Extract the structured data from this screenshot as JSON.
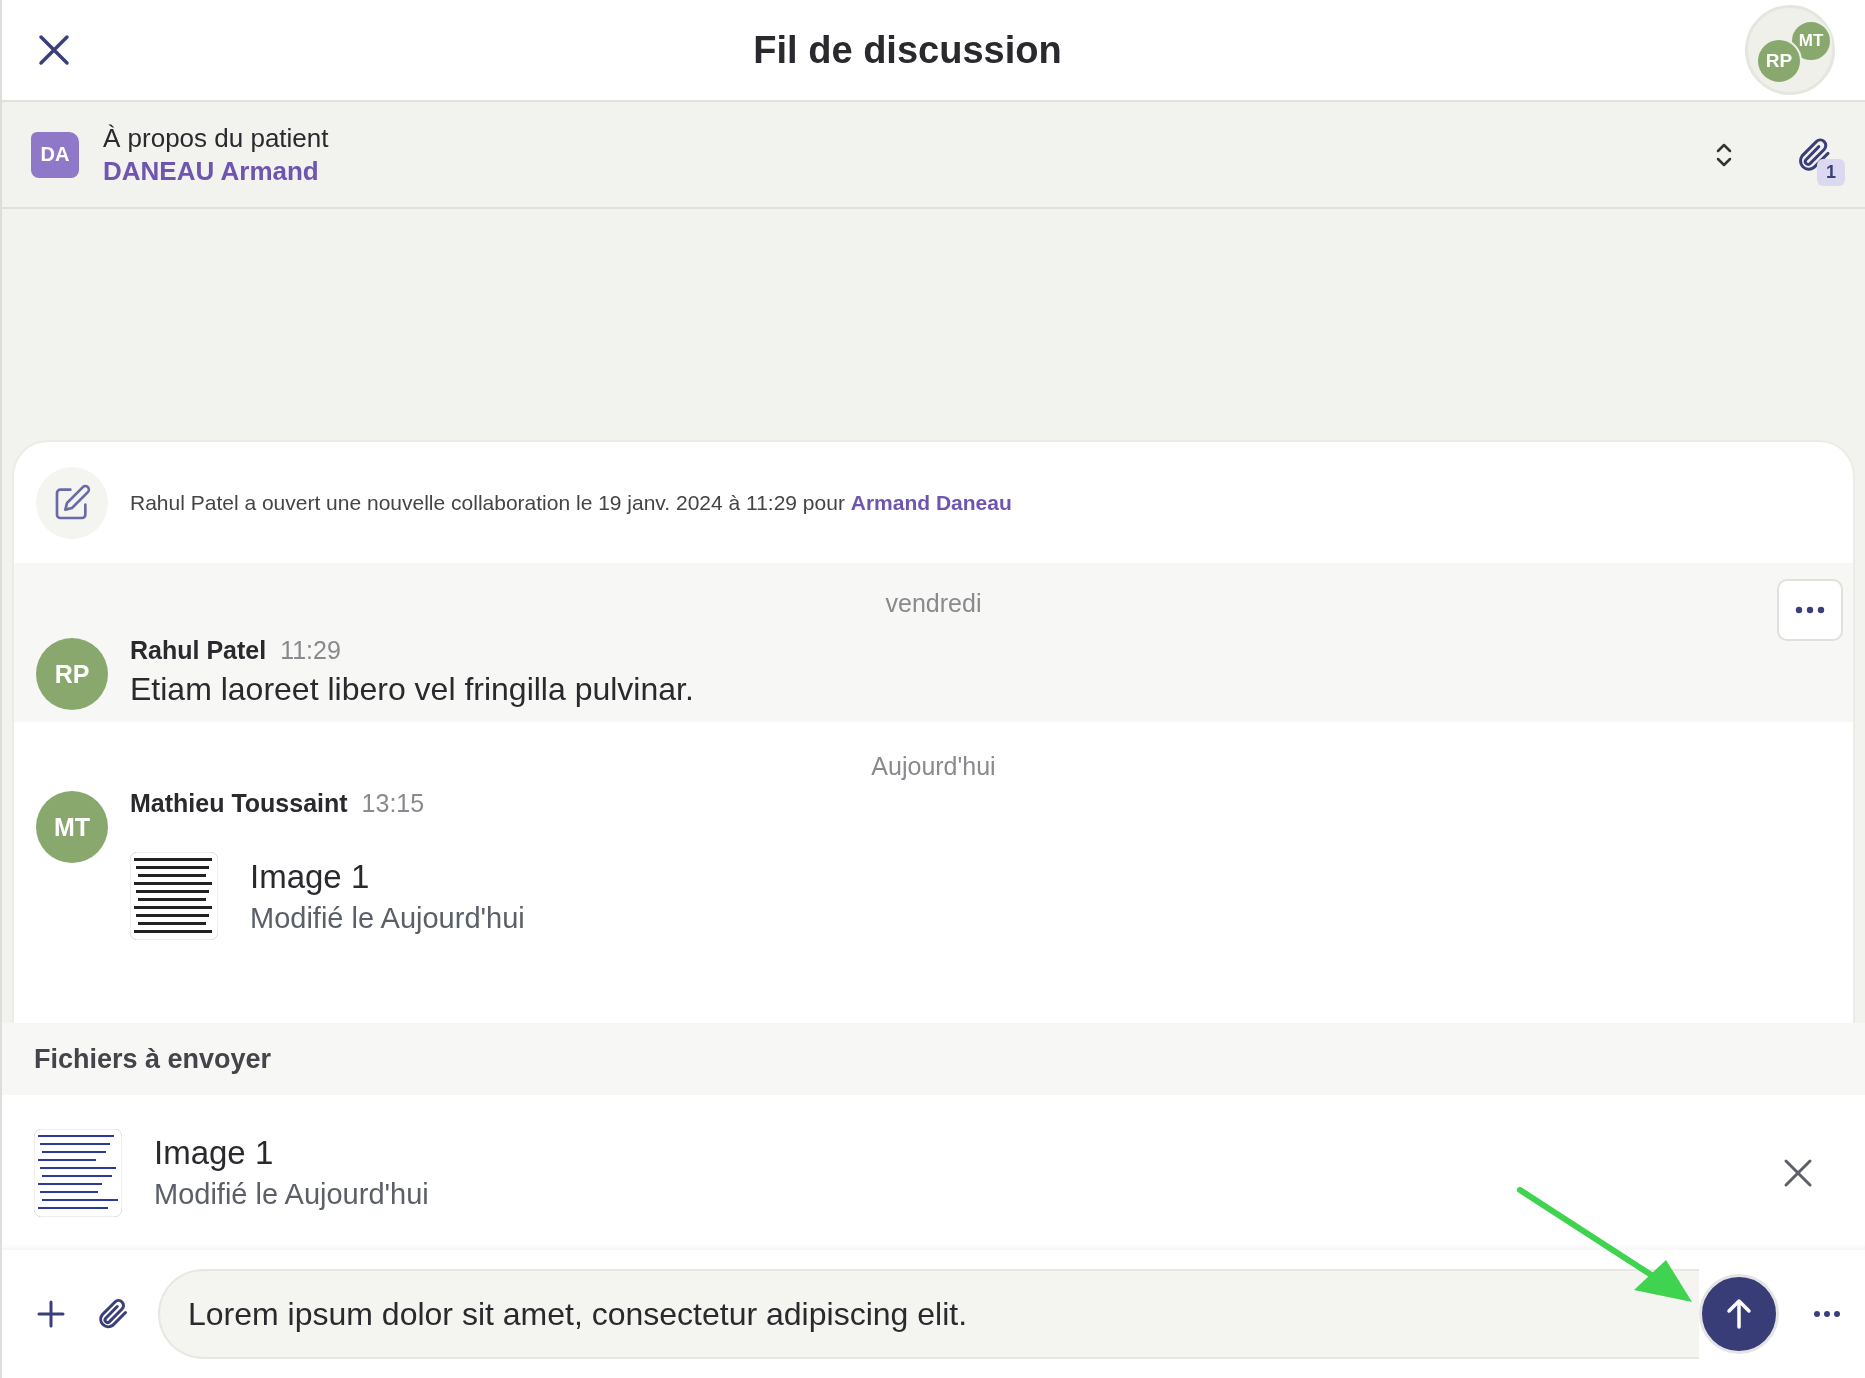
{
  "header": {
    "title": "Fil de discussion",
    "participants": [
      {
        "initials": "RP"
      },
      {
        "initials": "MT"
      }
    ]
  },
  "patient": {
    "initials": "DA",
    "label": "À propos du patient",
    "name": "DANEAU Armand",
    "attachment_count": "1"
  },
  "system_event": {
    "text": "Rahul Patel a ouvert une nouvelle collaboration le 19 janv. 2024 à 11:29 pour",
    "link": "Armand Daneau"
  },
  "groups": [
    {
      "date": "vendredi",
      "highlighted": true,
      "messages": [
        {
          "initials": "RP",
          "author": "Rahul Patel",
          "time": "11:29",
          "kind": "text",
          "text": "Etiam laoreet libero vel fringilla pulvinar."
        }
      ]
    },
    {
      "date": "Aujourd'hui",
      "highlighted": false,
      "messages": [
        {
          "initials": "MT",
          "author": "Mathieu Toussaint",
          "time": "13:15",
          "kind": "file",
          "file": {
            "name": "Image 1",
            "meta": "Modifié le Aujourd'hui"
          }
        }
      ]
    }
  ],
  "pending_files": {
    "title": "Fichiers à envoyer",
    "files": [
      {
        "name": "Image 1",
        "meta": "Modifié le Aujourd'hui"
      }
    ]
  },
  "composer": {
    "value": "Lorem ipsum dolor sit amet, consectetur adipiscing elit."
  }
}
